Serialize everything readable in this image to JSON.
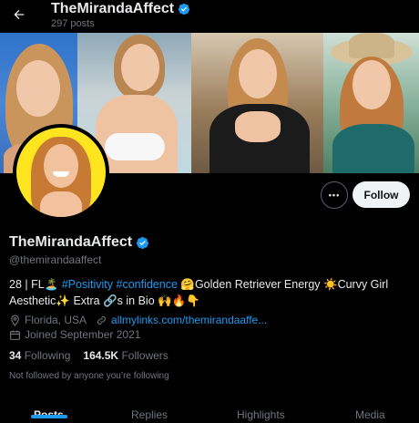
{
  "header": {
    "back_icon": "arrow-left-icon",
    "name": "TheMirandaAffect",
    "posts_count": "297 posts"
  },
  "colors": {
    "background": "#000000",
    "accent": "#1d9bf0",
    "text_primary": "#e7e9ea",
    "text_secondary": "#71767b",
    "avatar_ring": "#ffe51f"
  },
  "actions": {
    "more_icon": "more-horizontal-icon",
    "more_label": "•••",
    "follow_label": "Follow"
  },
  "profile": {
    "display_name": "TheMirandaAffect",
    "handle": "@themirandaaffect",
    "bio": {
      "part1": "28 | FL🏝️ ",
      "hashtag1": "#Positivity",
      "space": " ",
      "hashtag2": "#confidence",
      "part2": " 🤗Golden Retriever Energy ☀️Curvy Girl Aesthetic✨ Extra 🔗s in Bio 🙌🔥👇"
    },
    "location": "Florida, USA",
    "website": "allmylinks.com/themirandaaffe...",
    "joined": "Joined September 2021",
    "following_count": "34",
    "following_label": "Following",
    "followers_count": "164.5K",
    "followers_label": "Followers",
    "not_followed": "Not followed by anyone you’re following"
  },
  "tabs": [
    {
      "label": "Posts",
      "active": true
    },
    {
      "label": "Replies",
      "active": false
    },
    {
      "label": "Highlights",
      "active": false
    },
    {
      "label": "Media",
      "active": false
    }
  ]
}
